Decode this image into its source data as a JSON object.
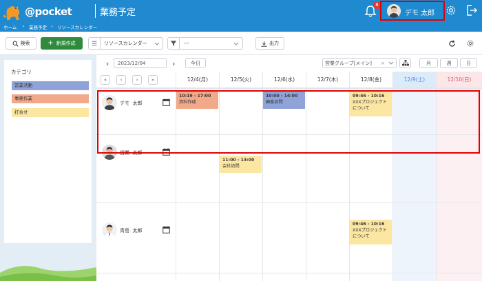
{
  "header": {
    "brand": "@pocket",
    "page_title": "業務予定",
    "notification_count": "8",
    "user_name": "デモ 太郎"
  },
  "breadcrumb": {
    "home": "ホーム",
    "business": "業務予定",
    "resource": "リソースカレンダー"
  },
  "toolbar": {
    "search_label": "検索",
    "new_label": "新規作成",
    "view_select": "リソースカレンダー",
    "filter_select": "---",
    "export_label": "出力"
  },
  "sidebar": {
    "title": "カテゴリ",
    "categories": [
      {
        "label": "営業活動",
        "color": "#8fa3d9"
      },
      {
        "label": "事務作業",
        "color": "#f2a98a"
      },
      {
        "label": "打合せ",
        "color": "#fbe6a2"
      }
    ]
  },
  "calendar": {
    "date": "2023/12/04",
    "today_label": "今日",
    "group_select": "営業グループ[メイン]",
    "view_month": "月",
    "view_week": "週",
    "view_day": "日",
    "days": [
      "12/4(月)",
      "12/5(火)",
      "12/6(水)",
      "12/7(木)",
      "12/8(金)",
      "12/9(土)",
      "12/10(日)"
    ],
    "people": [
      {
        "name": "デモ  太郎"
      },
      {
        "name": "営業  太郎"
      },
      {
        "name": "青島  太郎"
      }
    ],
    "events": [
      {
        "time": "10:19 - 17:00",
        "title": "資料作成",
        "color": "#f2a98a"
      },
      {
        "time": "10:00 - 14:00",
        "title": "顧客訪問",
        "color": "#8fa3d9"
      },
      {
        "time": "09:46 - 10:16",
        "title": "XXXプロジェクトについて",
        "color": "#fbe6a2"
      },
      {
        "time": "11:00 - 13:00",
        "title": "会社訪問",
        "color": "#fbe6a2"
      },
      {
        "time": "09:46 - 10:16",
        "title": "XXXプロジェクトについて",
        "color": "#fbe6a2"
      }
    ]
  },
  "colors": {
    "primary": "#1f8ad0",
    "highlight": "#e00000",
    "new_button": "#2e8b3c"
  }
}
